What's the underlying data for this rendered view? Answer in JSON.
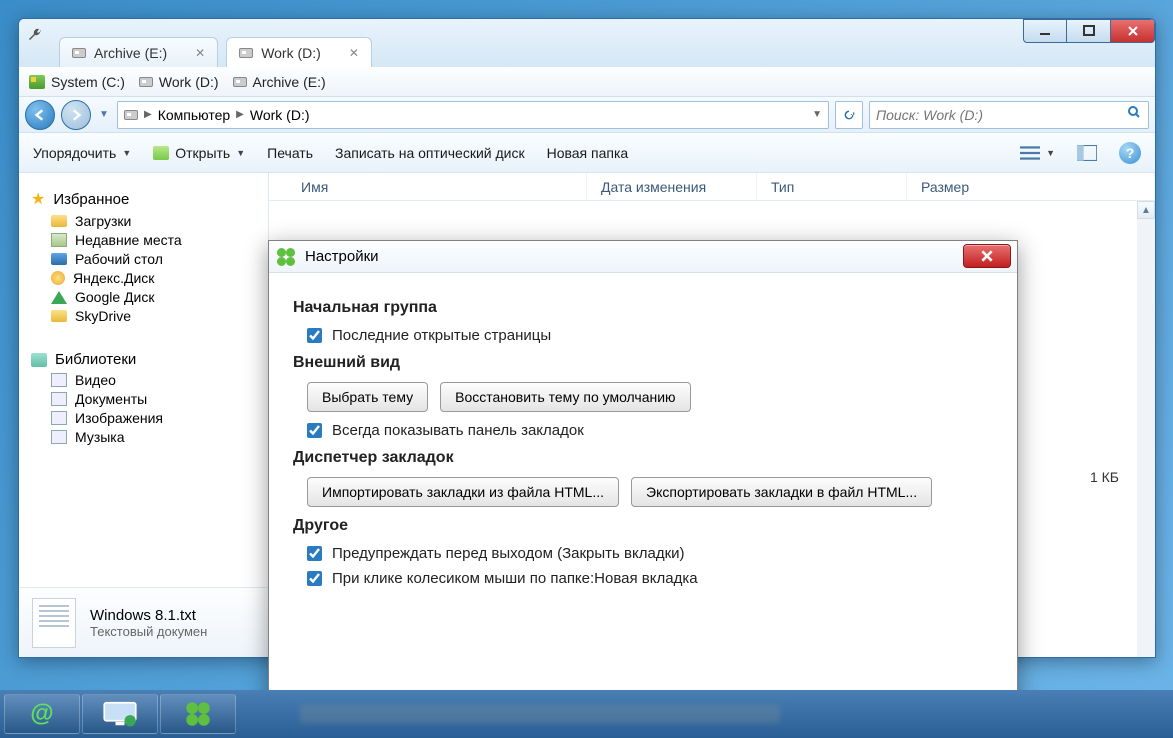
{
  "window": {
    "tabs": [
      {
        "label": "Archive (E:)",
        "active": false
      },
      {
        "label": "Work (D:)",
        "active": true
      }
    ],
    "bookmarks": [
      {
        "label": "System (C:)"
      },
      {
        "label": "Work (D:)"
      },
      {
        "label": "Archive (E:)"
      }
    ],
    "breadcrumb": {
      "root": "Компьютер",
      "current": "Work (D:)"
    },
    "search_placeholder": "Поиск: Work (D:)",
    "toolbar": {
      "organize": "Упорядочить",
      "open": "Открыть",
      "print": "Печать",
      "burn": "Записать на оптический диск",
      "new_folder": "Новая папка"
    },
    "columns": {
      "name": "Имя",
      "date": "Дата изменения",
      "type": "Тип",
      "size": "Размер"
    },
    "sidebar": {
      "favorites_title": "Избранное",
      "favorites": [
        "Загрузки",
        "Недавние места",
        "Рабочий стол",
        "Яндекс.Диск",
        "Google Диск",
        "SkyDrive"
      ],
      "libraries_title": "Библиотеки",
      "libraries": [
        "Видео",
        "Документы",
        "Изображения",
        "Музыка"
      ]
    },
    "details": {
      "filename": "Windows 8.1.txt",
      "filetype": "Текстовый докумен"
    },
    "visible_size": "1 КБ"
  },
  "dialog": {
    "title": "Настройки",
    "sections": {
      "start_group": {
        "heading": "Начальная группа",
        "last_pages": "Последние открытые страницы"
      },
      "appearance": {
        "heading": "Внешний вид",
        "choose_theme": "Выбрать тему",
        "restore_theme": "Восстановить тему по умолчанию",
        "show_bookmarks_bar": "Всегда показывать панель закладок"
      },
      "bookmarks_mgr": {
        "heading": "Диспетчер закладок",
        "import_btn": "Импортировать закладки из файла HTML...",
        "export_btn": "Экспортировать закладки в файл HTML..."
      },
      "other": {
        "heading": "Другое",
        "warn_exit": "Предупреждать перед выходом (Закрыть вкладки)",
        "wheel_click": "При клике колесиком мыши по папке:Новая вкладка"
      }
    }
  }
}
